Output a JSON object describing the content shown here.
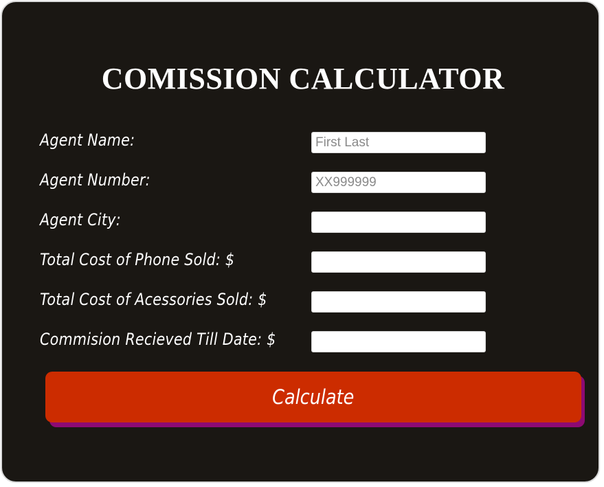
{
  "title": "COMISSION CALCULATOR",
  "fields": [
    {
      "label": "Agent Name:",
      "placeholder": "First Last",
      "value": ""
    },
    {
      "label": "Agent Number:",
      "placeholder": "XX999999",
      "value": ""
    },
    {
      "label": "Agent City:",
      "placeholder": "",
      "value": ""
    },
    {
      "label": "Total Cost of Phone Sold: $",
      "placeholder": "",
      "value": ""
    },
    {
      "label": "Total Cost of Acessories Sold: $",
      "placeholder": "",
      "value": ""
    },
    {
      "label": "Commision Recieved Till Date: $",
      "placeholder": "",
      "value": ""
    }
  ],
  "button": {
    "label": "Calculate"
  },
  "colors": {
    "card_background": "#1a1713",
    "button": "#cc2c00",
    "button_shadow": "#8d0a73",
    "text": "#ffffff"
  }
}
